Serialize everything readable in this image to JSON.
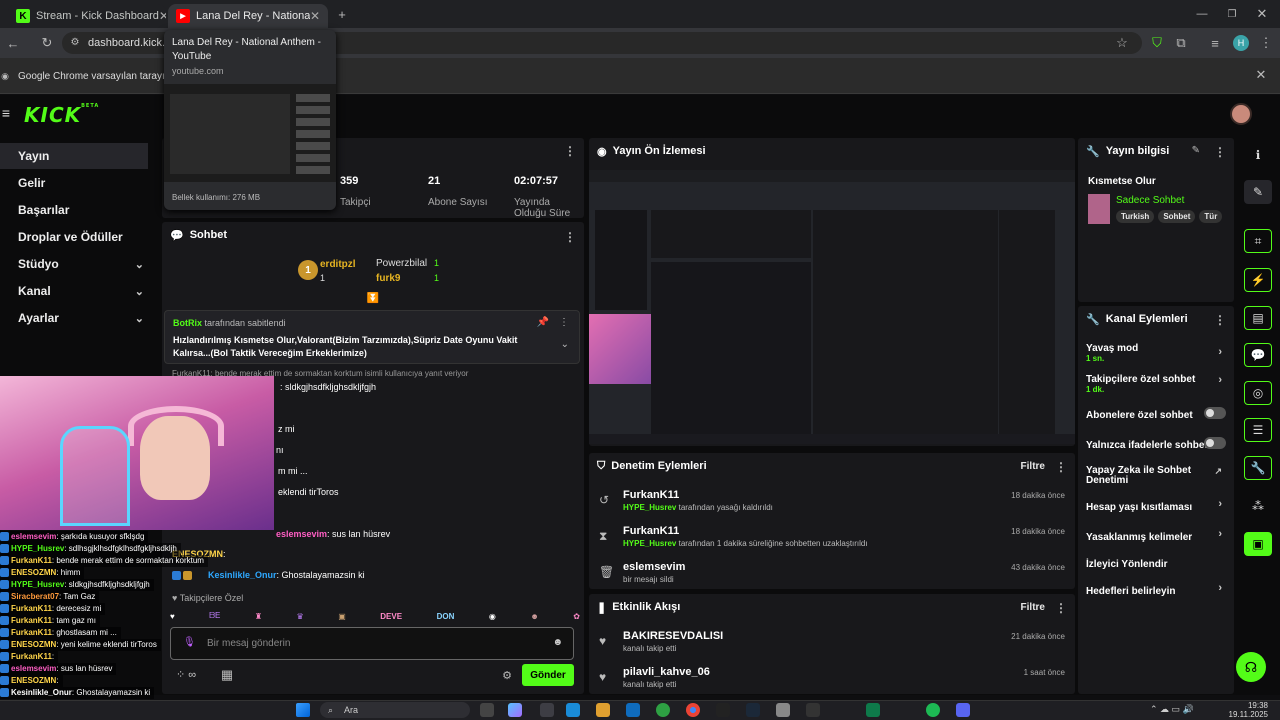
{
  "browser": {
    "tabs": [
      {
        "title": "Stream - Kick Dashboard"
      },
      {
        "title": "Lana Del Rey - National Anthem"
      }
    ],
    "url": "dashboard.kick.co",
    "infobar_text": "Google Chrome varsayılan tarayıcınız",
    "tooltip": {
      "title": "Lana Del Rey - National Anthem - YouTube",
      "host": "youtube.com",
      "memory": "Bellek kullanımı: 276 MB"
    },
    "profile_initial": "H"
  },
  "kick": {
    "logo": "KICK",
    "logo_sup": "BETA",
    "nav": [
      "Yayın",
      "Gelir",
      "Başarılar",
      "Droplar ve Ödüller",
      "Stüdyo",
      "Kanal",
      "Ayarlar"
    ],
    "stats": [
      {
        "value": "359",
        "label": "Takipçi"
      },
      {
        "value": "21",
        "label": "Abone Sayısı"
      },
      {
        "value": "02:07:57",
        "label": "Yayında Olduğu Süre"
      }
    ],
    "chat": {
      "title": "Sohbet",
      "leaders": [
        {
          "rank": "1",
          "name": "Powerzbilal",
          "count": "1"
        },
        {
          "rank": "2",
          "name": "erditpzl",
          "count": "1"
        },
        {
          "rank": "",
          "name": "furk9",
          "count": "1"
        }
      ],
      "pinned_by": "BotRix",
      "pinned_suffix": "tarafından sabitlendi",
      "pinned_text": "Hızlandırılmış Kısmetse Olur,Valorant(Bizim Tarzımızda),Süpriz Date Oyunu Vakit Kalırsa...(Bol Taktik Vereceğim Erkeklerimize)",
      "reply_hint": "FurkanK11: bende merak ettim de sormaktan korktum isimli kullanıcıya yanıt veriyor",
      "messages": [
        {
          "user": "",
          "text": ": sldkgjhsdfkljghsdkljfgjh"
        },
        {
          "user": "",
          "text": "z mi"
        },
        {
          "user": "",
          "text": "nı"
        },
        {
          "user": "",
          "text": "m mi ..."
        },
        {
          "user": "",
          "text": "eklendi tirToros"
        },
        {
          "user": "eslemsevim",
          "text": ": sus lan hüsrev"
        },
        {
          "user": "ENESOZMN",
          "text": ":"
        },
        {
          "user": "Kesinlikle_Onur",
          "text": ": Ghostalayamazsin ki"
        }
      ],
      "followers_only": "Takipçilere Özel",
      "emote_labels": [
        "DEVE",
        "DON"
      ],
      "input_placeholder": "Bir mesaj gönderin",
      "send": "Gönder",
      "infinite": "∞"
    },
    "preview_title": "Yayın Ön İzlemesi",
    "mod": {
      "title": "Denetim Eylemleri",
      "filter": "Filtre",
      "items": [
        {
          "name": "FurkanK11",
          "by": "HYPE_Husrev",
          "desc": "tarafından yasağı kaldırıldı",
          "time": "18 dakika önce"
        },
        {
          "name": "FurkanK11",
          "by": "HYPE_Husrev",
          "desc": "tarafından 1 dakika süreliğine sohbetten uzaklaştırıldı",
          "time": "18 dakika önce"
        },
        {
          "name": "eslemsevim",
          "by": "",
          "desc": "bir mesajı sildi",
          "time": "43 dakika önce"
        }
      ]
    },
    "activity": {
      "title": "Etkinlik Akışı",
      "filter": "Filtre",
      "items": [
        {
          "name": "BAKIRESEVDALISI",
          "desc": "kanalı takip etti",
          "time": "21 dakika önce"
        },
        {
          "name": "pilavli_kahve_06",
          "desc": "kanalı takip etti",
          "time": "1 saat önce"
        }
      ]
    },
    "stream_info": {
      "title": "Yayın bilgisi",
      "stream_title": "Kısmetse Olur",
      "category": "Sadece Sohbet",
      "tags": [
        "Turkish",
        "Sohbet",
        "Tür"
      ]
    },
    "channel_actions": {
      "title": "Kanal Eylemleri",
      "items": [
        {
          "label": "Yavaş mod",
          "sub": "1 sn."
        },
        {
          "label": "Takipçilere özel sohbet",
          "sub": "1 dk."
        },
        {
          "label": "Abonelere özel sohbet",
          "sub": ""
        },
        {
          "label": "Yalnızca ifadelerle sohbet",
          "sub": ""
        },
        {
          "label": "Yapay Zeka ile Sohbet Denetimi",
          "sub": ""
        },
        {
          "label": "Hesap yaşı kısıtlaması",
          "sub": ""
        },
        {
          "label": "Yasaklanmış kelimeler",
          "sub": ""
        },
        {
          "label": "İzleyici Yönlendir",
          "sub": ""
        },
        {
          "label": "Hedefleri belirleyin",
          "sub": ""
        }
      ]
    }
  },
  "overlay_chat": [
    {
      "user": "eslemsevim",
      "text": ": şarkıda kusuyor sfklşdg",
      "color": "#ff5ec4"
    },
    {
      "user": "HYPE_Husrev",
      "text": ": sdlhsgjklhsdfgklhsdfgkljhsdkljh",
      "color": "#53fc18"
    },
    {
      "user": "FurkanK11",
      "text": ": bende merak ettim de sormaktan korktum",
      "color": "#ffd54a"
    },
    {
      "user": "ENESOZMN",
      "text": ": himm",
      "color": "#ffd54a"
    },
    {
      "user": "HYPE_Husrev",
      "text": ": sldkgjhsdfkljghsdkljfgjh",
      "color": "#53fc18"
    },
    {
      "user": "Siracberat07",
      "text": ": Tam Gaz",
      "color": "#ff9a3c"
    },
    {
      "user": "FurkanK11",
      "text": ": derecesiz mi",
      "color": "#ffd54a"
    },
    {
      "user": "FurkanK11",
      "text": ": tam gaz mı",
      "color": "#ffd54a"
    },
    {
      "user": "FurkanK11",
      "text": ": ghostlasam mi ...",
      "color": "#ffd54a"
    },
    {
      "user": "ENESOZMN",
      "text": ": yeni kelime eklendi tirToros",
      "color": "#ffd54a"
    },
    {
      "user": "FurkanK11",
      "text": ":",
      "color": "#ffd54a"
    },
    {
      "user": "eslemsevim",
      "text": ": sus lan hüsrev",
      "color": "#ff5ec4"
    },
    {
      "user": "ENESOZMN",
      "text": ":",
      "color": "#ffd54a"
    },
    {
      "user": "Kesinlikle_Onur",
      "text": ": Ghostalayamazsin ki",
      "color": "#fff"
    }
  ],
  "taskbar": {
    "search": "Ara",
    "time": "19:38",
    "date": "19.11.2025"
  },
  "colors": {
    "accent": "#53fc18",
    "bg": "#0b0b0c",
    "panel": "#18181b"
  }
}
